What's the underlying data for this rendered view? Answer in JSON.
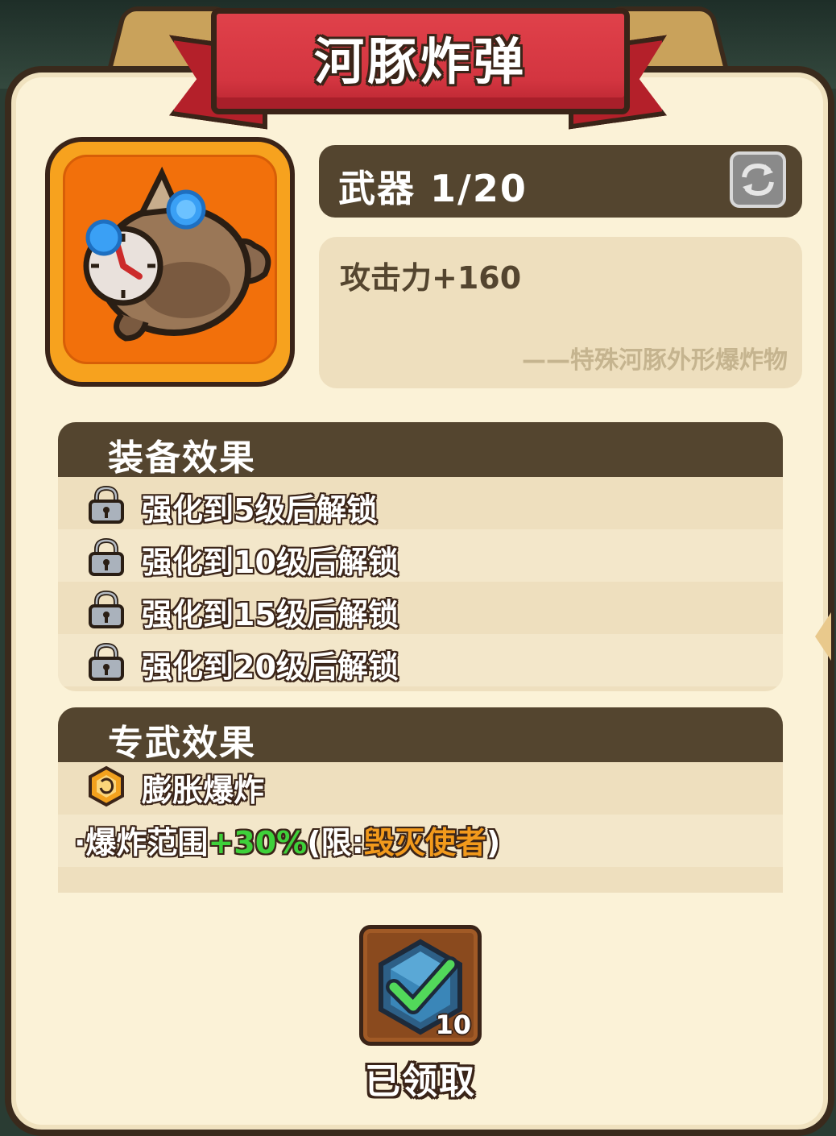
{
  "banner": {
    "title": "河豚炸弹"
  },
  "item": {
    "icon": "pufferfish-bomb-icon"
  },
  "header": {
    "weapon_label": "武器 1/20",
    "refresh_icon": "refresh-icon"
  },
  "description": {
    "stat": "攻击力+160",
    "flavor": "——特殊河豚外形爆炸物"
  },
  "equip_effects": {
    "title": "装备效果",
    "items": [
      {
        "label": "强化到5级后解锁"
      },
      {
        "label": "强化到10级后解锁"
      },
      {
        "label": "强化到15级后解锁"
      },
      {
        "label": "强化到20级后解锁"
      }
    ]
  },
  "exclusive_effects": {
    "title": "专武效果",
    "skill_name": "膨胀爆炸",
    "effect": {
      "prefix": "·爆炸范围",
      "bonus": "+30%",
      "limit_open": "(限:",
      "hero": "毁灭使者",
      "limit_close": ")"
    }
  },
  "reward": {
    "count": "10",
    "status": "已领取",
    "icon": "claimed-check-gem-icon"
  },
  "colors": {
    "banner_red": "#d33540",
    "header_brown": "#54452f",
    "item_orange": "#f2700b",
    "bonus_green": "#3ed13a",
    "hero_orange": "#f29a1c"
  }
}
